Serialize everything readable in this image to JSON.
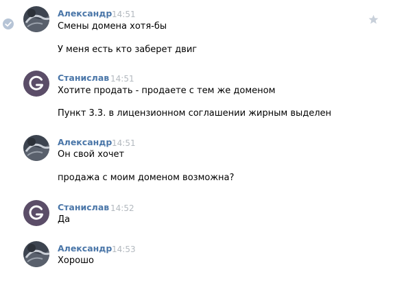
{
  "colors": {
    "author_name": "#4a76a8",
    "timestamp": "#b3b9bf",
    "message_text": "#000000",
    "avatar_g_bg": "#5b4d68",
    "star": "#c8d0da",
    "read_check_bg": "#b6c4d6"
  },
  "icons": {
    "star": "star-icon",
    "read_indicator": "check-circle-icon"
  },
  "messages": [
    {
      "author": "Александр",
      "time": "14:51",
      "avatar": "photo",
      "lines": [
        "Смены домена хотя-бы",
        "У меня есть кто заберет двиг"
      ]
    },
    {
      "author": "Станислав",
      "time": "14:51",
      "avatar": "letter-g",
      "lines": [
        "Хотите продать - продаете с тем же доменом",
        "Пункт 3.3. в лицензионном соглашении жирным выделен"
      ]
    },
    {
      "author": "Александр",
      "time": "14:51",
      "avatar": "photo",
      "lines": [
        "Он свой хочет",
        "продажа с моим доменом возможна?"
      ]
    },
    {
      "author": "Станислав",
      "time": "14:52",
      "avatar": "letter-g",
      "lines": [
        "Да"
      ]
    },
    {
      "author": "Александр",
      "time": "14:53",
      "avatar": "photo",
      "lines": [
        "Хорошо"
      ]
    }
  ]
}
